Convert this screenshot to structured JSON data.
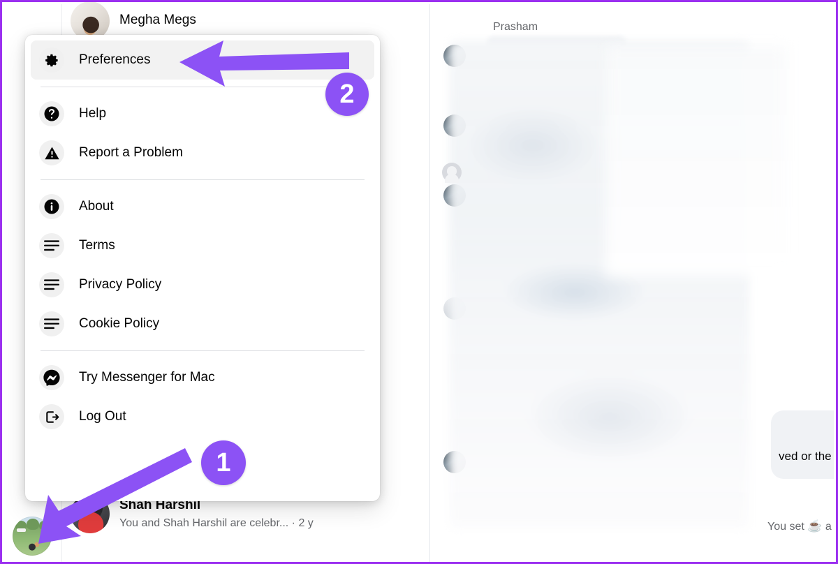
{
  "accent": {
    "purple": "#8C52F5",
    "frame_border": "#9B30F0",
    "menu_bg": "#FFFFFF",
    "highlight_bg": "#F2F2F2",
    "divider": "#DDDFE2",
    "text_primary": "#050505",
    "text_secondary": "#65676B"
  },
  "left_panel": {
    "top_chat": {
      "name": "Megha Megs",
      "avatar": "megha-avatar"
    },
    "bottom_chat": {
      "name": "Shah Harshil",
      "snippet": "You and Shah Harshil are celebr... · 2 y",
      "avatar": "shah-harshil-avatar"
    },
    "self_avatar_name": "your-profile-avatar",
    "ghost_avatar_name": "default-user-avatar"
  },
  "menu": {
    "sections": [
      {
        "items": [
          {
            "label": "Preferences",
            "icon": "gear-icon",
            "active": true
          }
        ]
      },
      {
        "items": [
          {
            "label": "Help",
            "icon": "question-mark-icon",
            "active": false
          },
          {
            "label": "Report a Problem",
            "icon": "warning-triangle-icon",
            "active": false
          }
        ]
      },
      {
        "items": [
          {
            "label": "About",
            "icon": "info-icon",
            "active": false
          },
          {
            "label": "Terms",
            "icon": "document-lines-icon",
            "active": false
          },
          {
            "label": "Privacy Policy",
            "icon": "document-lines-icon",
            "active": false
          },
          {
            "label": "Cookie Policy",
            "icon": "document-lines-icon",
            "active": false
          }
        ]
      },
      {
        "items": [
          {
            "label": "Try Messenger for Mac",
            "icon": "messenger-logo-icon",
            "active": false
          },
          {
            "label": "Log Out",
            "icon": "logout-icon",
            "active": false
          }
        ]
      }
    ]
  },
  "right_panel": {
    "thread_title": "Prasham",
    "partial_message": "ved or the p",
    "system_note_prefix": "You set ",
    "system_note_emoji": "☕",
    "system_note_suffix": " a"
  },
  "annotations": {
    "step_one": "1",
    "step_two": "2",
    "arrow_one_name": "arrow-pointing-to-profile-avatar",
    "arrow_two_name": "arrow-pointing-to-preferences"
  }
}
